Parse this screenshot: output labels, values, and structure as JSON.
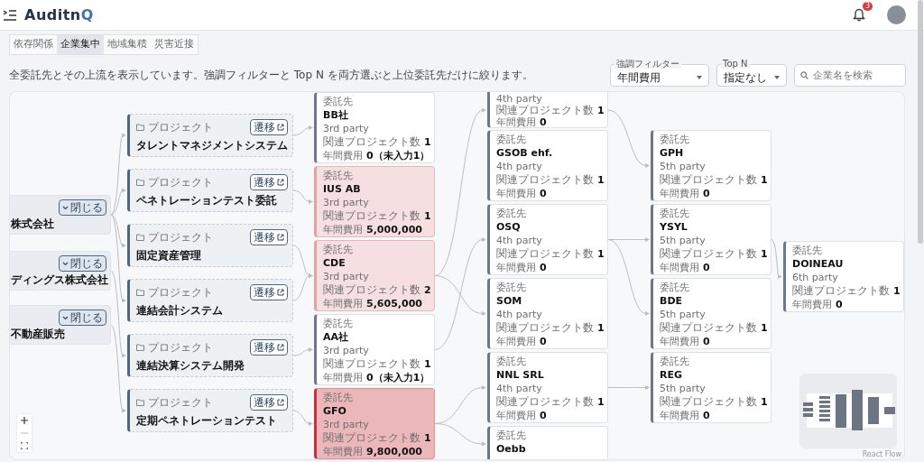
{
  "header": {
    "logo": {
      "text": "Auditn",
      "accent": "Q"
    },
    "notification_count": "3"
  },
  "tabs": [
    {
      "label": "依存関係",
      "selected": false
    },
    {
      "label": "企業集中",
      "selected": true
    },
    {
      "label": "地域集積",
      "selected": false
    },
    {
      "label": "災害近接",
      "selected": false
    }
  ],
  "description": "全委託先とその上流を表示しています。強調フィルターと Top N を両方選ぶと上位委託先だけに絞ります。",
  "filters": {
    "emphasis": {
      "label": "強調フィルター",
      "value": "年間費用"
    },
    "top_n": {
      "label": "Top N",
      "value": "指定なし"
    },
    "search": {
      "placeholder": "企業名を検索"
    }
  },
  "graph": {
    "companies": [
      {
        "name": "株式会社",
        "button": "閉じる"
      },
      {
        "name": "ディングス株式会社",
        "button": "閉じる"
      },
      {
        "name": "不動産販売",
        "button": "閉じる"
      }
    ],
    "projects": [
      {
        "label": "プロジェクト",
        "name": "タレントマネジメントシステム",
        "button": "遷移"
      },
      {
        "label": "プロジェクト",
        "name": "ペネトレーションテスト委託",
        "button": "遷移"
      },
      {
        "label": "プロジェクト",
        "name": "固定資産管理",
        "button": "遷移"
      },
      {
        "label": "プロジェクト",
        "name": "連結会計システム",
        "button": "遷移"
      },
      {
        "label": "プロジェクト",
        "name": "連結決算システム開発",
        "button": "遷移"
      },
      {
        "label": "プロジェクト",
        "name": "定期ペネトレーションテスト",
        "button": "遷移"
      }
    ],
    "vendor_columns": [
      [
        {
          "label": "委託先",
          "name": "BB社",
          "party": "3rd party",
          "count_label": "関連プロジェクト数",
          "count": "1",
          "cost_label": "年間費用",
          "cost": "0（未入力1）",
          "color": "#ffffff"
        },
        {
          "label": "委託先",
          "name": "IUS AB",
          "party": "3rd party",
          "count_label": "関連プロジェクト数",
          "count": "1",
          "cost_label": "年間費用",
          "cost": "5,000,000",
          "color": "#f6dfe0"
        },
        {
          "label": "委託先",
          "name": "CDE",
          "party": "3rd party",
          "count_label": "関連プロジェクト数",
          "count": "2",
          "cost_label": "年間費用",
          "cost": "5,605,000",
          "color": "#f6dfe0"
        },
        {
          "label": "委託先",
          "name": "AA社",
          "party": "3rd party",
          "count_label": "関連プロジェクト数",
          "count": "1",
          "cost_label": "年間費用",
          "cost": "0（未入力1）",
          "color": "#ffffff"
        },
        {
          "label": "委託先",
          "name": "GFO",
          "party": "3rd party",
          "count_label": "関連プロジェクト数",
          "count": "1",
          "cost_label": "年間費用",
          "cost": "9,800,000",
          "color": "#ebb7bb"
        }
      ],
      [
        {
          "party": "4th party",
          "count_label": "関連プロジェクト数",
          "count": "1",
          "cost_label": "年間費用",
          "cost": "0",
          "color": "#ffffff"
        },
        {
          "label": "委託先",
          "name": "GSOB ehf.",
          "party": "4th party",
          "count_label": "関連プロジェクト数",
          "count": "1",
          "cost_label": "年間費用",
          "cost": "0",
          "color": "#ffffff"
        },
        {
          "label": "委託先",
          "name": "OSQ",
          "party": "4th party",
          "count_label": "関連プロジェクト数",
          "count": "1",
          "cost_label": "年間費用",
          "cost": "0",
          "color": "#ffffff"
        },
        {
          "label": "委託先",
          "name": "SOM",
          "party": "4th party",
          "count_label": "関連プロジェクト数",
          "count": "1",
          "cost_label": "年間費用",
          "cost": "0",
          "color": "#ffffff"
        },
        {
          "label": "委託先",
          "name": "NNL SRL",
          "party": "4th party",
          "count_label": "関連プロジェクト数",
          "count": "1",
          "cost_label": "年間費用",
          "cost": "0",
          "color": "#ffffff"
        },
        {
          "label": "委託先",
          "name": "Oebb",
          "color": "#ffffff"
        }
      ],
      [
        {
          "label": "委託先",
          "name": "GPH",
          "party": "5th party",
          "count_label": "関連プロジェクト数",
          "count": "1",
          "cost_label": "年間費用",
          "cost": "0",
          "color": "#ffffff"
        },
        {
          "label": "委託先",
          "name": "YSYL",
          "party": "5th party",
          "count_label": "関連プロジェクト数",
          "count": "1",
          "cost_label": "年間費用",
          "cost": "0",
          "color": "#ffffff"
        },
        {
          "label": "委託先",
          "name": "BDE",
          "party": "5th party",
          "count_label": "関連プロジェクト数",
          "count": "1",
          "cost_label": "年間費用",
          "cost": "0",
          "color": "#ffffff"
        },
        {
          "label": "委託先",
          "name": "REG",
          "party": "5th party",
          "count_label": "関連プロジェクト数",
          "count": "1",
          "cost_label": "年間費用",
          "cost": "0",
          "color": "#ffffff"
        }
      ],
      [
        {
          "label": "委託先",
          "name": "DOINEAU",
          "party": "6th party",
          "count_label": "関連プロジェクト数",
          "count": "1",
          "cost_label": "年間費用",
          "cost": "0",
          "color": "#ffffff"
        }
      ]
    ]
  },
  "attribution": "React Flow"
}
